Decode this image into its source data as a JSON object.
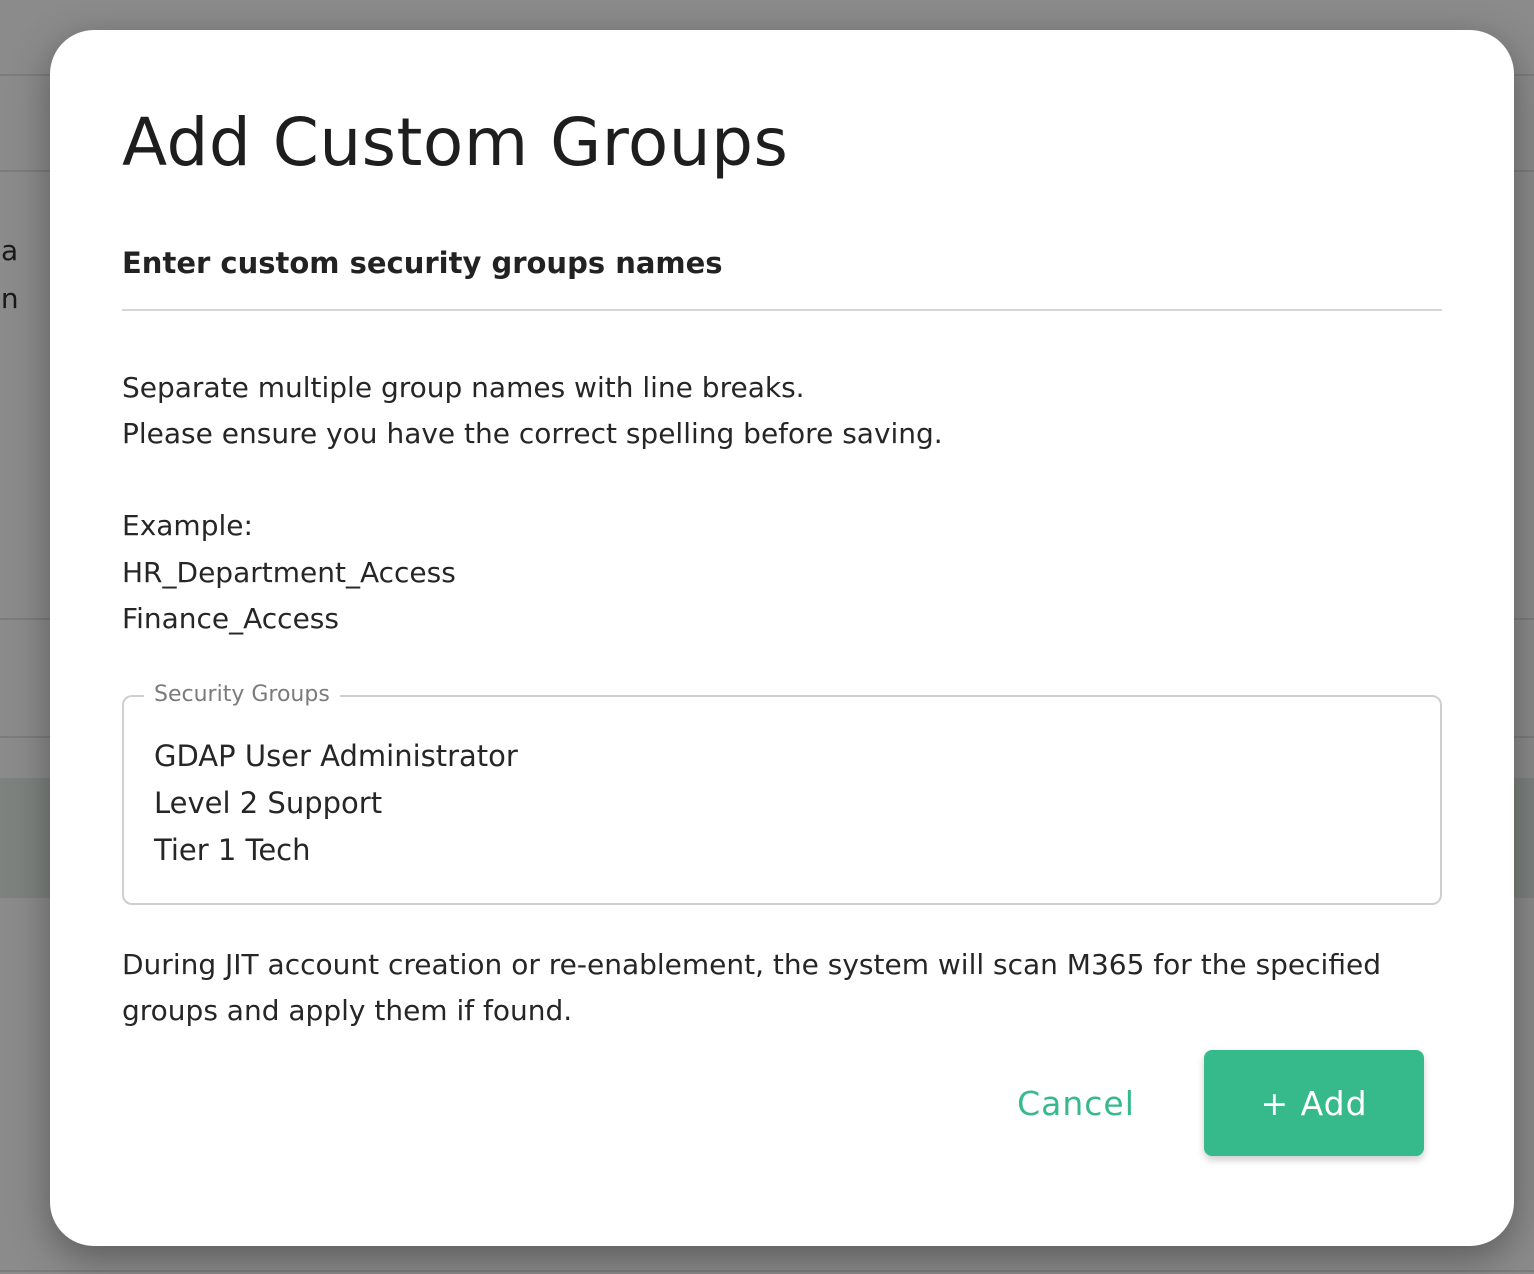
{
  "background": {
    "partial_text_lines": [
      "ena",
      "ann"
    ]
  },
  "dialog": {
    "title": "Add Custom Groups",
    "section_heading": "Enter custom security groups names",
    "instructions": [
      "Separate multiple group names with line breaks.",
      "Please ensure you have the correct spelling before saving."
    ],
    "example_label": "Example:",
    "examples": [
      "HR_Department_Access",
      "Finance_Access"
    ],
    "field": {
      "label": "Security Groups",
      "values": [
        "GDAP User Administrator",
        "Level 2 Support",
        "Tier 1 Tech"
      ]
    },
    "help_text": "During JIT account creation or re-enablement, the system will scan M365 for the specified groups and apply them if found.",
    "cancel_label": "Cancel",
    "add_label": "+ Add"
  },
  "colors": {
    "accent": "#36ba8c",
    "overlay": "#8a8a8a"
  }
}
